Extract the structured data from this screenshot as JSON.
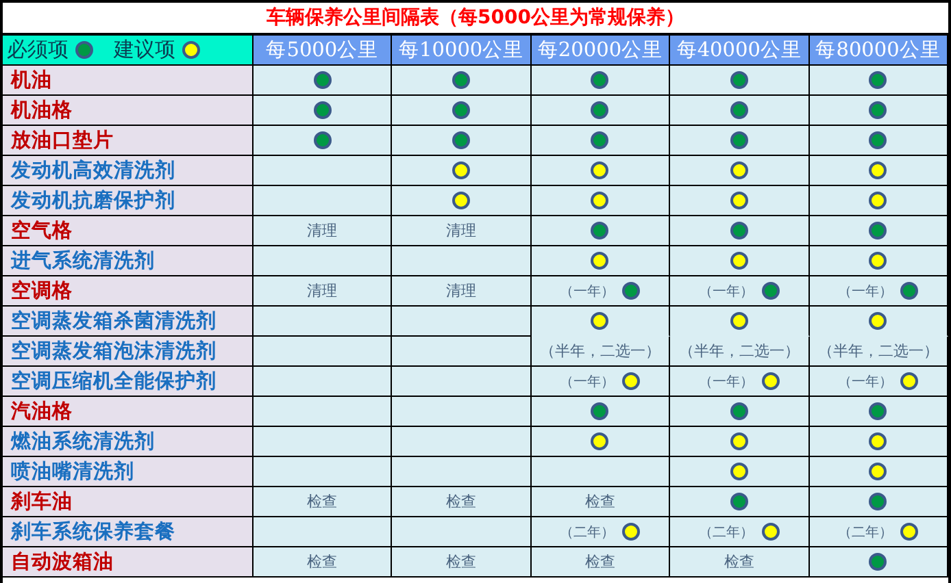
{
  "title": "车辆保养公里间隔表（每5000公里为常规保养）",
  "legend": [
    {
      "label": "必须项",
      "color": "#009944"
    },
    {
      "label": "建议项",
      "color": "#ffff00"
    }
  ],
  "columns": [
    "每5000公里",
    "每10000公里",
    "每20000公里",
    "每40000公里",
    "每80000公里"
  ],
  "rows": [
    {
      "name": "机油",
      "kind": "required",
      "cells": [
        {
          "color": "#009944"
        },
        {
          "color": "#009944"
        },
        {
          "color": "#009944"
        },
        {
          "color": "#009944"
        },
        {
          "color": "#009944"
        }
      ]
    },
    {
      "name": "机油格",
      "kind": "required",
      "cells": [
        {
          "color": "#009944"
        },
        {
          "color": "#009944"
        },
        {
          "color": "#009944"
        },
        {
          "color": "#009944"
        },
        {
          "color": "#009944"
        }
      ]
    },
    {
      "name": "放油口垫片",
      "kind": "required",
      "cells": [
        {
          "color": "#009944"
        },
        {
          "color": "#009944"
        },
        {
          "color": "#009944"
        },
        {
          "color": "#009944"
        },
        {
          "color": "#009944"
        }
      ]
    },
    {
      "name": "发动机高效清洗剂",
      "kind": "suggested",
      "cells": [
        null,
        {
          "color": "#ffff00"
        },
        {
          "color": "#ffff00"
        },
        {
          "color": "#ffff00"
        },
        {
          "color": "#ffff00"
        }
      ]
    },
    {
      "name": "发动机抗磨保护剂",
      "kind": "suggested",
      "cells": [
        null,
        {
          "color": "#ffff00"
        },
        {
          "color": "#ffff00"
        },
        {
          "color": "#ffff00"
        },
        {
          "color": "#ffff00"
        }
      ]
    },
    {
      "name": "空气格",
      "kind": "required",
      "cells": [
        {
          "note": "清理"
        },
        {
          "note": "清理"
        },
        {
          "color": "#009944"
        },
        {
          "color": "#009944"
        },
        {
          "color": "#009944"
        }
      ]
    },
    {
      "name": "进气系统清洗剂",
      "kind": "suggested",
      "cells": [
        null,
        null,
        {
          "color": "#ffff00"
        },
        {
          "color": "#ffff00"
        },
        {
          "color": "#ffff00"
        }
      ]
    },
    {
      "name": "空调格",
      "kind": "required",
      "cells": [
        {
          "note": "清理"
        },
        {
          "note": "清理"
        },
        {
          "note": "（一年）",
          "color": "#009944"
        },
        {
          "note": "（一年）",
          "color": "#009944"
        },
        {
          "note": "（一年）",
          "color": "#009944"
        }
      ]
    },
    {
      "name": "空调蒸发箱杀菌清洗剂",
      "kind": "suggested",
      "cells": [
        null,
        null,
        {
          "color": "#ffff00",
          "joined": true
        },
        {
          "color": "#ffff00",
          "joined": true
        },
        {
          "color": "#ffff00",
          "joined": true
        }
      ]
    },
    {
      "name": "空调蒸发箱泡沫清洗剂",
      "kind": "suggested",
      "cells": [
        null,
        null,
        {
          "note": "（半年，二选一）"
        },
        {
          "note": "（半年，二选一）"
        },
        {
          "note": "（半年，二选一）"
        }
      ]
    },
    {
      "name": "空调压缩机全能保护剂",
      "kind": "suggested",
      "cells": [
        null,
        null,
        {
          "note": "（一年）",
          "color": "#ffff00"
        },
        {
          "note": "（一年）",
          "color": "#ffff00"
        },
        {
          "note": "（一年）",
          "color": "#ffff00"
        }
      ]
    },
    {
      "name": "汽油格",
      "kind": "required",
      "cells": [
        null,
        null,
        {
          "color": "#009944"
        },
        {
          "color": "#009944"
        },
        {
          "color": "#009944"
        }
      ]
    },
    {
      "name": "燃油系统清洗剂",
      "kind": "suggested",
      "cells": [
        null,
        null,
        {
          "color": "#ffff00"
        },
        {
          "color": "#ffff00"
        },
        {
          "color": "#ffff00"
        }
      ]
    },
    {
      "name": "喷油嘴清洗剂",
      "kind": "suggested",
      "cells": [
        null,
        null,
        null,
        {
          "color": "#ffff00"
        },
        {
          "color": "#ffff00"
        }
      ]
    },
    {
      "name": "刹车油",
      "kind": "required",
      "cells": [
        {
          "note": "检查"
        },
        {
          "note": "检查"
        },
        {
          "note": "检查"
        },
        {
          "color": "#009944"
        },
        {
          "color": "#009944"
        }
      ]
    },
    {
      "name": "刹车系统保养套餐",
      "kind": "suggested",
      "cells": [
        null,
        null,
        {
          "note": "（二年）",
          "color": "#ffff00"
        },
        {
          "note": "（二年）",
          "color": "#ffff00"
        },
        {
          "note": "（二年）",
          "color": "#ffff00"
        }
      ]
    },
    {
      "name": "自动波箱油",
      "kind": "required",
      "cells": [
        {
          "note": "检查"
        },
        {
          "note": "检查"
        },
        {
          "note": "检查"
        },
        {
          "note": "检查"
        },
        {
          "color": "#009944"
        }
      ]
    }
  ]
}
